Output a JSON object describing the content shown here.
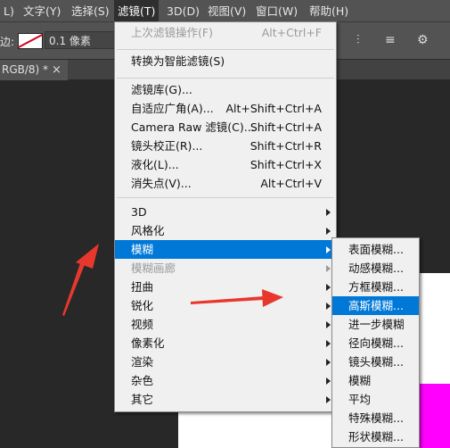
{
  "menubar": {
    "items": [
      {
        "label": "L)"
      },
      {
        "label": "文字(Y)"
      },
      {
        "label": "选择(S)"
      },
      {
        "label": "滤镜(T)"
      },
      {
        "label": "3D(D)"
      },
      {
        "label": "视图(V)"
      },
      {
        "label": "窗口(W)"
      },
      {
        "label": "帮助(H)"
      }
    ]
  },
  "options_bar": {
    "stroke_label": "边:",
    "stroke_width": "0.1 像素",
    "icon_names": [
      "align-icon",
      "arrange-icon",
      "gear-icon"
    ]
  },
  "document_tab": {
    "title": "RGB/8) *",
    "close": "×"
  },
  "filter_menu": {
    "last_filter": {
      "label": "上次滤镜操作(F)",
      "shortcut": "Alt+Ctrl+F"
    },
    "convert_smart": {
      "label": "转换为智能滤镜(S)"
    },
    "group2": [
      {
        "label": "滤镜库(G)...",
        "shortcut": ""
      },
      {
        "label": "自适应广角(A)...",
        "shortcut": "Alt+Shift+Ctrl+A"
      },
      {
        "label": "Camera Raw 滤镜(C)...",
        "shortcut": "Shift+Ctrl+A"
      },
      {
        "label": "镜头校正(R)...",
        "shortcut": "Shift+Ctrl+R"
      },
      {
        "label": "液化(L)...",
        "shortcut": "Shift+Ctrl+X"
      },
      {
        "label": "消失点(V)...",
        "shortcut": "Alt+Ctrl+V"
      }
    ],
    "group3": [
      {
        "label": "3D"
      },
      {
        "label": "风格化"
      },
      {
        "label": "模糊"
      },
      {
        "label": "模糊画廊"
      },
      {
        "label": "扭曲"
      },
      {
        "label": "锐化"
      },
      {
        "label": "视频"
      },
      {
        "label": "像素化"
      },
      {
        "label": "渲染"
      },
      {
        "label": "杂色"
      },
      {
        "label": "其它"
      }
    ],
    "highlighted_item": "模糊",
    "disabled_items": [
      "上次滤镜操作(F)",
      "模糊画廊"
    ]
  },
  "blur_submenu": {
    "items": [
      {
        "label": "表面模糊..."
      },
      {
        "label": "动感模糊..."
      },
      {
        "label": "方框模糊..."
      },
      {
        "label": "高斯模糊..."
      },
      {
        "label": "进一步模糊"
      },
      {
        "label": "径向模糊..."
      },
      {
        "label": "镜头模糊..."
      },
      {
        "label": "模糊"
      },
      {
        "label": "平均"
      },
      {
        "label": "特殊模糊..."
      },
      {
        "label": "形状模糊..."
      }
    ],
    "highlighted_item": "高斯模糊..."
  },
  "colors": {
    "ui_dark": "#282828",
    "menubar": "#535353",
    "menu_bg": "#f0f0f0",
    "highlight": "#0078d7",
    "annotation_arrow": "#e8382e",
    "canvas_magenta": "#ff00ff"
  }
}
